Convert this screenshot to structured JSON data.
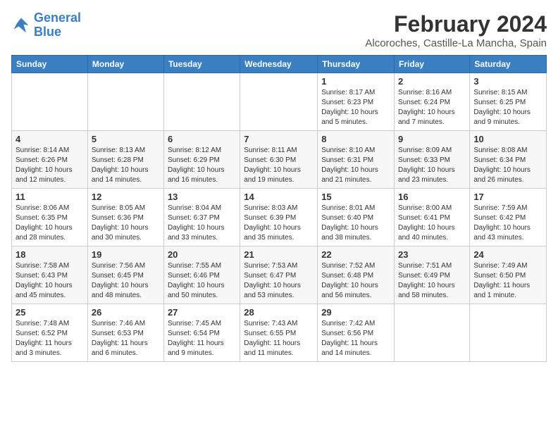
{
  "header": {
    "logo_line1": "General",
    "logo_line2": "Blue",
    "title": "February 2024",
    "location": "Alcoroches, Castille-La Mancha, Spain"
  },
  "weekdays": [
    "Sunday",
    "Monday",
    "Tuesday",
    "Wednesday",
    "Thursday",
    "Friday",
    "Saturday"
  ],
  "weeks": [
    [
      {
        "day": "",
        "info": ""
      },
      {
        "day": "",
        "info": ""
      },
      {
        "day": "",
        "info": ""
      },
      {
        "day": "",
        "info": ""
      },
      {
        "day": "1",
        "info": "Sunrise: 8:17 AM\nSunset: 6:23 PM\nDaylight: 10 hours\nand 5 minutes."
      },
      {
        "day": "2",
        "info": "Sunrise: 8:16 AM\nSunset: 6:24 PM\nDaylight: 10 hours\nand 7 minutes."
      },
      {
        "day": "3",
        "info": "Sunrise: 8:15 AM\nSunset: 6:25 PM\nDaylight: 10 hours\nand 9 minutes."
      }
    ],
    [
      {
        "day": "4",
        "info": "Sunrise: 8:14 AM\nSunset: 6:26 PM\nDaylight: 10 hours\nand 12 minutes."
      },
      {
        "day": "5",
        "info": "Sunrise: 8:13 AM\nSunset: 6:28 PM\nDaylight: 10 hours\nand 14 minutes."
      },
      {
        "day": "6",
        "info": "Sunrise: 8:12 AM\nSunset: 6:29 PM\nDaylight: 10 hours\nand 16 minutes."
      },
      {
        "day": "7",
        "info": "Sunrise: 8:11 AM\nSunset: 6:30 PM\nDaylight: 10 hours\nand 19 minutes."
      },
      {
        "day": "8",
        "info": "Sunrise: 8:10 AM\nSunset: 6:31 PM\nDaylight: 10 hours\nand 21 minutes."
      },
      {
        "day": "9",
        "info": "Sunrise: 8:09 AM\nSunset: 6:33 PM\nDaylight: 10 hours\nand 23 minutes."
      },
      {
        "day": "10",
        "info": "Sunrise: 8:08 AM\nSunset: 6:34 PM\nDaylight: 10 hours\nand 26 minutes."
      }
    ],
    [
      {
        "day": "11",
        "info": "Sunrise: 8:06 AM\nSunset: 6:35 PM\nDaylight: 10 hours\nand 28 minutes."
      },
      {
        "day": "12",
        "info": "Sunrise: 8:05 AM\nSunset: 6:36 PM\nDaylight: 10 hours\nand 30 minutes."
      },
      {
        "day": "13",
        "info": "Sunrise: 8:04 AM\nSunset: 6:37 PM\nDaylight: 10 hours\nand 33 minutes."
      },
      {
        "day": "14",
        "info": "Sunrise: 8:03 AM\nSunset: 6:39 PM\nDaylight: 10 hours\nand 35 minutes."
      },
      {
        "day": "15",
        "info": "Sunrise: 8:01 AM\nSunset: 6:40 PM\nDaylight: 10 hours\nand 38 minutes."
      },
      {
        "day": "16",
        "info": "Sunrise: 8:00 AM\nSunset: 6:41 PM\nDaylight: 10 hours\nand 40 minutes."
      },
      {
        "day": "17",
        "info": "Sunrise: 7:59 AM\nSunset: 6:42 PM\nDaylight: 10 hours\nand 43 minutes."
      }
    ],
    [
      {
        "day": "18",
        "info": "Sunrise: 7:58 AM\nSunset: 6:43 PM\nDaylight: 10 hours\nand 45 minutes."
      },
      {
        "day": "19",
        "info": "Sunrise: 7:56 AM\nSunset: 6:45 PM\nDaylight: 10 hours\nand 48 minutes."
      },
      {
        "day": "20",
        "info": "Sunrise: 7:55 AM\nSunset: 6:46 PM\nDaylight: 10 hours\nand 50 minutes."
      },
      {
        "day": "21",
        "info": "Sunrise: 7:53 AM\nSunset: 6:47 PM\nDaylight: 10 hours\nand 53 minutes."
      },
      {
        "day": "22",
        "info": "Sunrise: 7:52 AM\nSunset: 6:48 PM\nDaylight: 10 hours\nand 56 minutes."
      },
      {
        "day": "23",
        "info": "Sunrise: 7:51 AM\nSunset: 6:49 PM\nDaylight: 10 hours\nand 58 minutes."
      },
      {
        "day": "24",
        "info": "Sunrise: 7:49 AM\nSunset: 6:50 PM\nDaylight: 11 hours\nand 1 minute."
      }
    ],
    [
      {
        "day": "25",
        "info": "Sunrise: 7:48 AM\nSunset: 6:52 PM\nDaylight: 11 hours\nand 3 minutes."
      },
      {
        "day": "26",
        "info": "Sunrise: 7:46 AM\nSunset: 6:53 PM\nDaylight: 11 hours\nand 6 minutes."
      },
      {
        "day": "27",
        "info": "Sunrise: 7:45 AM\nSunset: 6:54 PM\nDaylight: 11 hours\nand 9 minutes."
      },
      {
        "day": "28",
        "info": "Sunrise: 7:43 AM\nSunset: 6:55 PM\nDaylight: 11 hours\nand 11 minutes."
      },
      {
        "day": "29",
        "info": "Sunrise: 7:42 AM\nSunset: 6:56 PM\nDaylight: 11 hours\nand 14 minutes."
      },
      {
        "day": "",
        "info": ""
      },
      {
        "day": "",
        "info": ""
      }
    ]
  ]
}
